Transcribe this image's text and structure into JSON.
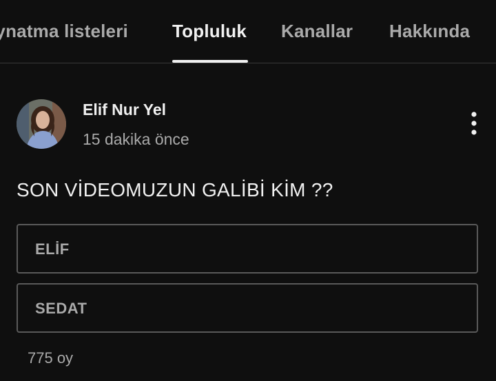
{
  "tabs": [
    {
      "label": "Oynatma listeleri"
    },
    {
      "label": "Topluluk",
      "active": true
    },
    {
      "label": "Kanallar"
    },
    {
      "label": "Hakkında"
    }
  ],
  "post": {
    "author": "Elif Nur Yel",
    "time": "15 dakika önce",
    "text": "SON VİDEOMUZUN GALİBİ KİM ??",
    "poll": {
      "options": [
        "ELİF",
        "SEDAT"
      ],
      "votes": "775 oy"
    }
  },
  "icons": {
    "menu": "more-vert-icon",
    "avatar": "avatar-photo"
  },
  "colors": {
    "background": "#0f0f0f",
    "primary_text": "#f1f1f1",
    "secondary_text": "#aaaaaa",
    "poll_border": "#5a5a5a"
  }
}
